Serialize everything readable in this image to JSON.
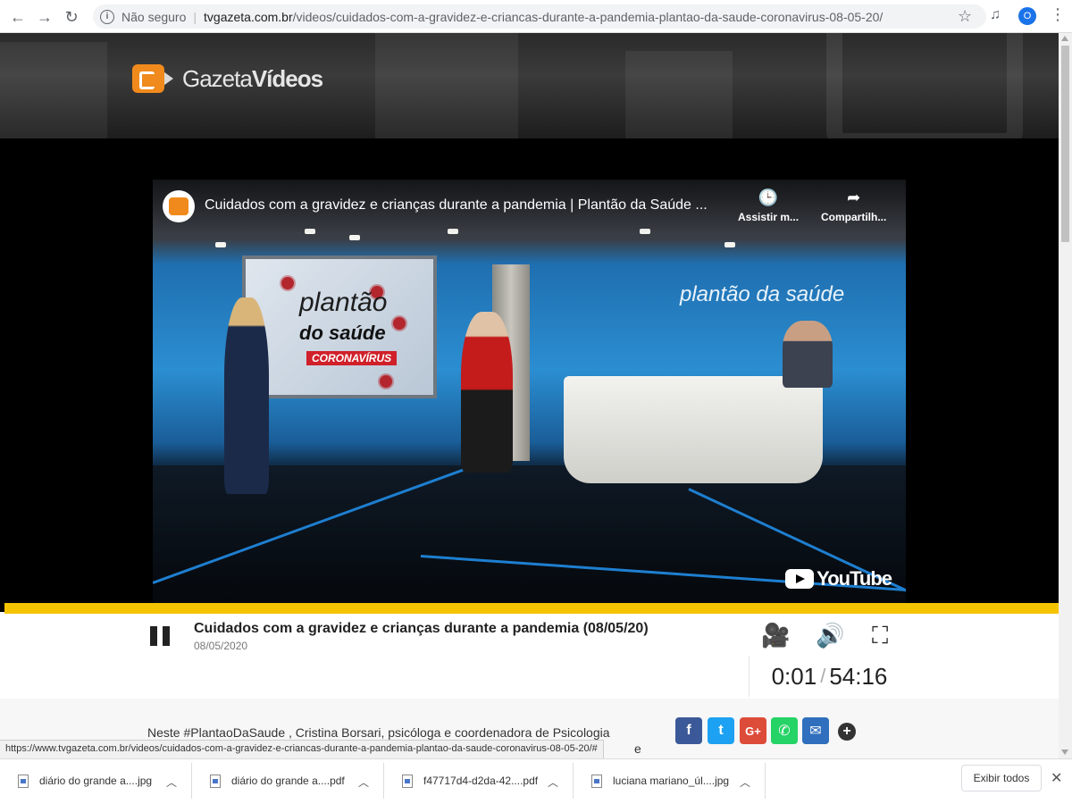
{
  "browser": {
    "security_label": "Não seguro",
    "url_domain": "tvgazeta.com.br",
    "url_path": "/videos/cuidados-com-a-gravidez-e-criancas-durante-a-pandemia-plantao-da-saude-coronavirus-08-05-20/",
    "profile_initial": "O"
  },
  "site": {
    "logo_text_light": "Gazeta",
    "logo_text_bold": "Vídeos"
  },
  "youtube": {
    "title": "Cuidados com a gravidez e crianças durante a pandemia | Plantão da Saúde ...",
    "watch_later_label": "Assistir m...",
    "share_label": "Compartilh...",
    "brand": "YouTube"
  },
  "studio": {
    "screen_line1": "plantão",
    "screen_line2": "do saúde",
    "screen_line3": "CORONAVÍRUS",
    "wall_text": "plantão da saúde"
  },
  "player": {
    "title": "Cuidados com a gravidez e crianças durante a pandemia (08/05/20)",
    "date": "08/05/2020",
    "current_time": "0:01",
    "total_time": "54:16",
    "progress": 0.0003
  },
  "description": {
    "line1": "Neste #PlantaoDaSaude , Cristina Borsari, psicóloga e coordenadora de Psicologia",
    "continuation": "e a"
  },
  "social": {
    "google_plus_label": "G+",
    "plus_label": "+"
  },
  "status_bar_url": "https://www.tvgazeta.com.br/videos/cuidados-com-a-gravidez-e-criancas-durante-a-pandemia-plantao-da-saude-coronavirus-08-05-20/#",
  "downloads": {
    "items": [
      {
        "name": "diário do grande a....jpg"
      },
      {
        "name": "diário do grande a....pdf"
      },
      {
        "name": "f47717d4-d2da-42....pdf"
      },
      {
        "name": "luciana mariano_úl....jpg"
      }
    ],
    "show_all_label": "Exibir todos"
  }
}
